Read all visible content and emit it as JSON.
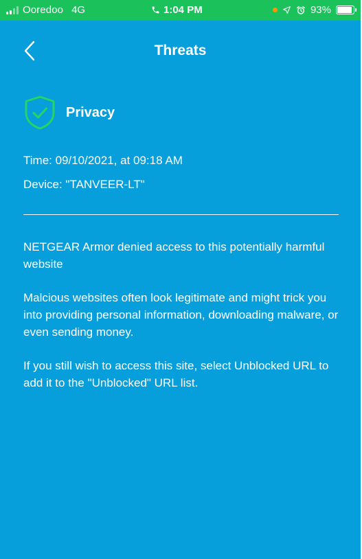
{
  "status_bar": {
    "carrier": "Ooredoo",
    "network": "4G",
    "time": "1:04 PM",
    "battery": "93%",
    "battery_level": 0.93,
    "icons": [
      "signal-icon",
      "phone-icon",
      "location-arrow-icon",
      "alarm-icon",
      "battery-icon"
    ],
    "background_color": "#1bc15a"
  },
  "header": {
    "back_icon": "chevron-left-icon",
    "title": "Threats"
  },
  "threat": {
    "icon": "shield-check-icon",
    "icon_color": "#25d366",
    "category": "Privacy",
    "time_line": "Time: 09/10/2021, at 09:18 AM",
    "device_line": "Device: \"TANVEER-LT\""
  },
  "messages": [
    "NETGEAR Armor denied access to this potentially harmful website",
    "Malcious websites often look legitimate and might trick you into providing personal information, downloading malware, or even sending money.",
    "If you still wish to access this site, select Unblocked URL to add it to the \"Unblocked\" URL list."
  ],
  "colors": {
    "background": "#069edb",
    "text": "#ffffff"
  }
}
